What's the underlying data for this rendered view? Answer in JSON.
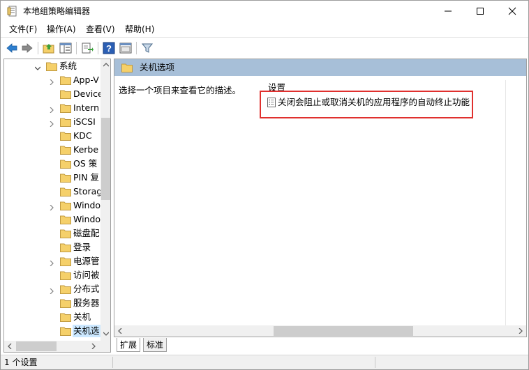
{
  "window": {
    "title": "本地组策略编辑器",
    "icon": "gpedit-app-icon"
  },
  "menu": [
    {
      "label": "文件(F)"
    },
    {
      "label": "操作(A)"
    },
    {
      "label": "查看(V)"
    },
    {
      "label": "帮助(H)"
    }
  ],
  "toolbar": {
    "buttons": [
      "back-arrow-icon",
      "forward-arrow-icon",
      "up-folder-icon",
      "show-hide-tree-icon",
      "export-list-icon",
      "help-icon",
      "properties-icon",
      "filter-icon"
    ]
  },
  "tree": {
    "items": [
      {
        "label": "系统",
        "expandable": true,
        "expanded": true,
        "level": 0
      },
      {
        "label": "App-V",
        "expandable": true,
        "level": 1
      },
      {
        "label": "Device",
        "expandable": false,
        "level": 1
      },
      {
        "label": "Intern",
        "expandable": true,
        "level": 1
      },
      {
        "label": "iSCSI",
        "expandable": true,
        "level": 1
      },
      {
        "label": "KDC",
        "expandable": false,
        "level": 1
      },
      {
        "label": "Kerbe",
        "expandable": false,
        "level": 1
      },
      {
        "label": "OS 策",
        "expandable": false,
        "level": 1
      },
      {
        "label": "PIN 复",
        "expandable": false,
        "level": 1
      },
      {
        "label": "Storag",
        "expandable": false,
        "level": 1
      },
      {
        "label": "Windo",
        "expandable": true,
        "level": 1
      },
      {
        "label": "Windo",
        "expandable": false,
        "level": 1
      },
      {
        "label": "磁盘配",
        "expandable": false,
        "level": 1
      },
      {
        "label": "登录",
        "expandable": false,
        "level": 1
      },
      {
        "label": "电源管",
        "expandable": true,
        "level": 1
      },
      {
        "label": "访问被",
        "expandable": false,
        "level": 1
      },
      {
        "label": "分布式",
        "expandable": true,
        "level": 1
      },
      {
        "label": "服务器",
        "expandable": false,
        "level": 1
      },
      {
        "label": "关机",
        "expandable": false,
        "level": 1
      },
      {
        "label": "关机选",
        "expandable": false,
        "level": 1,
        "selected": true
      }
    ]
  },
  "details": {
    "path_title": "关机选项",
    "description": "选择一个项目来查看它的描述。",
    "column_header": "设置",
    "settings": [
      {
        "label": "关闭会阻止或取消关机的应用程序的自动终止功能",
        "icon": "policy-setting-icon"
      }
    ]
  },
  "tabs": [
    {
      "label": "扩展",
      "active": true
    },
    {
      "label": "标准",
      "active": false
    }
  ],
  "status": {
    "text": "1 个设置"
  },
  "colors": {
    "header_bg": "#a7bfd8",
    "highlight_border": "#e0302e",
    "selection_bg": "#cce8ff",
    "folder_yellow": "#f5d06a"
  }
}
